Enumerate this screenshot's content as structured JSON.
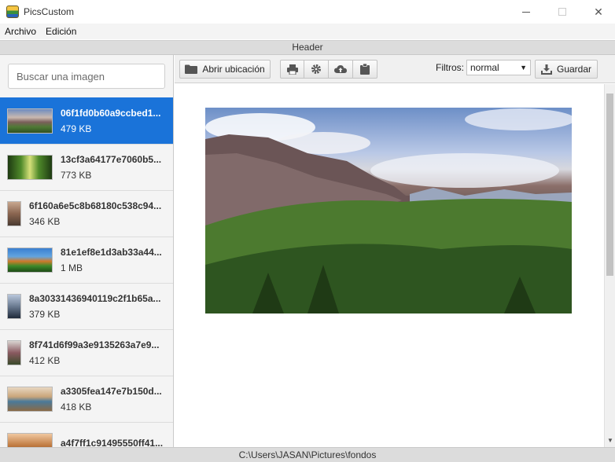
{
  "window": {
    "title": "PicsCustom"
  },
  "menu": {
    "file": "Archivo",
    "edit": "Edición"
  },
  "header": {
    "label": "Header"
  },
  "search": {
    "placeholder": "Buscar una imagen"
  },
  "files": [
    {
      "name": "06f1fd0b60a9ccbed1...",
      "size": "479 KB",
      "selected": true
    },
    {
      "name": "13cf3a64177e7060b5...",
      "size": "773 KB"
    },
    {
      "name": "6f160a6e5c8b68180c538c94...",
      "size": "346 KB"
    },
    {
      "name": "81e1ef8e1d3ab33a44...",
      "size": "1 MB"
    },
    {
      "name": "8a30331436940119c2f1b65a...",
      "size": "379 KB"
    },
    {
      "name": "8f741d6f99a3e9135263a7e9...",
      "size": "412 KB"
    },
    {
      "name": "a3305fea147e7b150d...",
      "size": "418 KB"
    },
    {
      "name": "a4f7ff1c91495550ff41...",
      "size": ""
    }
  ],
  "toolbar": {
    "open_label": "Abrir ubicación",
    "filters_label": "Filtros:",
    "filter_value": "normal",
    "save_label": "Guardar"
  },
  "status": {
    "path": "C:\\Users\\JASAN\\Pictures\\fondos"
  },
  "colors": {
    "selection": "#1a73d9"
  }
}
